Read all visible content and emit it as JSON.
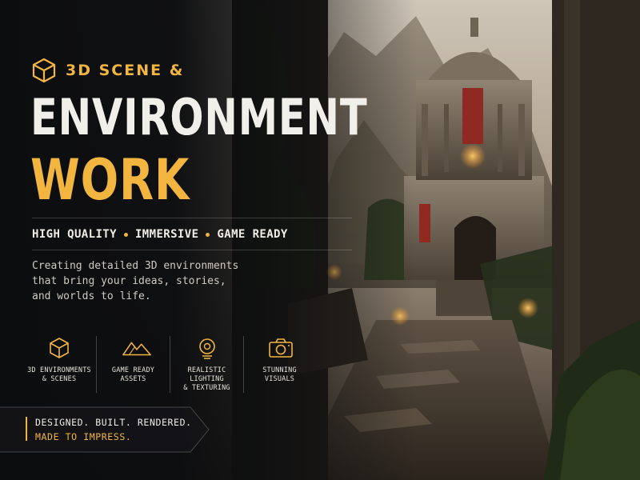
{
  "header": {
    "eyebrow": "3D SCENE &",
    "title_line1": "ENVIRONMENT",
    "title_line2": "WORK"
  },
  "tagline": {
    "items": [
      "HIGH QUALITY",
      "IMMERSIVE",
      "GAME READY"
    ]
  },
  "description": "Creating detailed 3D environments that bring your ideas, stories, and worlds to life.",
  "features": [
    {
      "icon": "cube-icon",
      "label": "3D ENVIRONMENTS\n& SCENES"
    },
    {
      "icon": "mountains-icon",
      "label": "GAME READY\nASSETS"
    },
    {
      "icon": "light-globe-icon",
      "label": "REALISTIC LIGHTING\n& TEXTURING"
    },
    {
      "icon": "camera-icon",
      "label": "STUNNING\nVISUALS"
    }
  ],
  "banner": {
    "line1": "DESIGNED. BUILT. RENDERED.",
    "line2": "MADE TO IMPRESS."
  },
  "colors": {
    "accent": "#f2b540",
    "background": "#0d0e10",
    "text": "#f1efea"
  }
}
